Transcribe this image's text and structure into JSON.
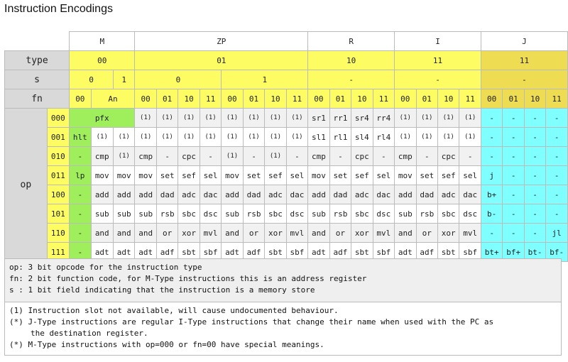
{
  "title": "Instruction Encodings",
  "type_headers": {
    "m": "M",
    "zp": "ZP",
    "r": "R",
    "i": "I",
    "j": "J"
  },
  "row_labels": {
    "type": "type",
    "s": "s",
    "fn": "fn",
    "op": "op"
  },
  "type_row": {
    "m": "00",
    "zp": "01",
    "r": "10",
    "i": "11",
    "j": "11"
  },
  "s_row": {
    "m0": "0",
    "m1": "1",
    "zp0": "0",
    "zp1": "1",
    "r": "-",
    "i": "-",
    "j": "-"
  },
  "fn_row": {
    "m00": "00",
    "man": "An",
    "codes": [
      "00",
      "01",
      "10",
      "11"
    ]
  },
  "opcodes": [
    "000",
    "001",
    "010",
    "011",
    "100",
    "101",
    "110",
    "111"
  ],
  "m_cells": {
    "pfx": "pfx",
    "rows": [
      [
        "hlt",
        "(1)",
        "(1)"
      ],
      [
        "-",
        "cmp",
        "(1)"
      ],
      [
        "lp",
        "mov",
        "mov"
      ],
      [
        "-",
        "add",
        "add"
      ],
      [
        "-",
        "sub",
        "sub"
      ],
      [
        "-",
        "and",
        "and"
      ],
      [
        "-",
        "adt",
        "adt"
      ]
    ]
  },
  "rows": [
    {
      "zp": [
        "(1)",
        "(1)",
        "(1)",
        "(1)",
        "(1)",
        "(1)",
        "(1)",
        "(1)"
      ],
      "r": [
        "sr1",
        "rr1",
        "sr4",
        "rr4"
      ],
      "i": [
        "(1)",
        "(1)",
        "(1)",
        "(1)"
      ],
      "j": [
        "-",
        "-",
        "-",
        "-"
      ]
    },
    {
      "zp": [
        "(1)",
        "(1)",
        "(1)",
        "(1)",
        "(1)",
        "(1)",
        "(1)",
        "(1)"
      ],
      "r": [
        "sl1",
        "rl1",
        "sl4",
        "rl4"
      ],
      "i": [
        "(1)",
        "(1)",
        "(1)",
        "(1)"
      ],
      "j": [
        "-",
        "-",
        "-",
        "-"
      ]
    },
    {
      "zp": [
        "cmp",
        "-",
        "cpc",
        "-",
        "(1)",
        "-",
        "(1)",
        "-"
      ],
      "r": [
        "cmp",
        "-",
        "cpc",
        "-"
      ],
      "i": [
        "cmp",
        "-",
        "cpc",
        "-"
      ],
      "j": [
        "-",
        "-",
        "-",
        "-"
      ]
    },
    {
      "zp": [
        "mov",
        "set",
        "sef",
        "sel",
        "mov",
        "set",
        "sef",
        "sel"
      ],
      "r": [
        "mov",
        "set",
        "sef",
        "sel"
      ],
      "i": [
        "mov",
        "set",
        "sef",
        "sel"
      ],
      "j": [
        "j",
        "-",
        "-",
        "-"
      ]
    },
    {
      "zp": [
        "add",
        "dad",
        "adc",
        "dac",
        "add",
        "dad",
        "adc",
        "dac"
      ],
      "r": [
        "add",
        "dad",
        "adc",
        "dac"
      ],
      "i": [
        "add",
        "dad",
        "adc",
        "dac"
      ],
      "j": [
        "b+",
        "-",
        "-",
        "-"
      ]
    },
    {
      "zp": [
        "sub",
        "rsb",
        "sbc",
        "dsc",
        "sub",
        "rsb",
        "sbc",
        "dsc"
      ],
      "r": [
        "sub",
        "rsb",
        "sbc",
        "dsc"
      ],
      "i": [
        "sub",
        "rsb",
        "sbc",
        "dsc"
      ],
      "j": [
        "b-",
        "-",
        "-",
        "-"
      ]
    },
    {
      "zp": [
        "and",
        "or",
        "xor",
        "mvl",
        "and",
        "or",
        "xor",
        "mvl"
      ],
      "r": [
        "and",
        "or",
        "xor",
        "mvl"
      ],
      "i": [
        "and",
        "or",
        "xor",
        "mvl"
      ],
      "j": [
        "-",
        "-",
        "-",
        "jl"
      ]
    },
    {
      "zp": [
        "adt",
        "adf",
        "sbt",
        "sbf",
        "adt",
        "adf",
        "sbt",
        "sbf"
      ],
      "r": [
        "adt",
        "adf",
        "sbt",
        "sbf"
      ],
      "i": [
        "adt",
        "adf",
        "sbt",
        "sbf"
      ],
      "j": [
        "bt+",
        "bf+",
        "bt-",
        "bf-"
      ]
    }
  ],
  "legend": [
    "op: 3 bit opcode for the instruction type",
    "fn: 2 bit function code, for  M-Type instructions this is an address register",
    "s : 1 bit field indicating that the instruction is a memory store"
  ],
  "notes": [
    "(1) Instruction slot not available, will cause undocumented behaviour.",
    "(*) J-Type instructions are regular I-Type instructions that change their name when used with the PC as",
    "the destination register.",
    "(*) M-Type instructions with op=000 or fn=00 have special meanings."
  ],
  "colors": {
    "header_gray": "#d9d9d9",
    "yellow": "#fdfd63",
    "j_yellow": "#eedc52",
    "cyan": "#7fffff",
    "green": "#9fee5c",
    "row_gray": "#f1f1f1"
  }
}
